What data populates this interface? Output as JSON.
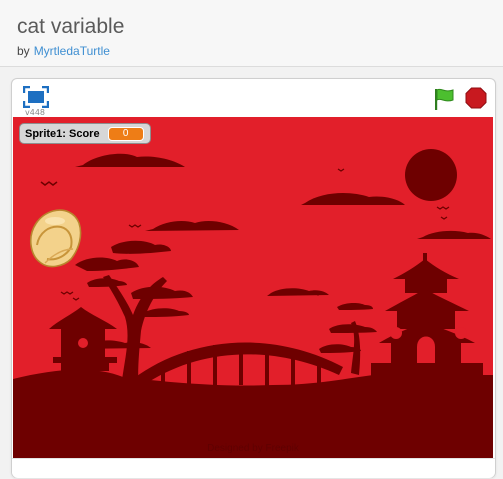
{
  "project": {
    "title": "cat variable",
    "by_label": "by",
    "author": "MyrtledaTurtle"
  },
  "player": {
    "version": "v448",
    "icons": {
      "fullscreen": "fullscreen-icon",
      "green_flag": "green-flag-icon",
      "stop": "stop-sign-icon"
    },
    "colors": {
      "stage_background": "#e21f2a",
      "silhouette": "#6e0000",
      "monitor_value": "#ee7d16",
      "flag": "#4cbf2f",
      "stop": "#c8191f"
    }
  },
  "stage": {
    "monitor": {
      "label": "Sprite1: Score",
      "value": "0"
    },
    "sprite": "fortune-cookie",
    "watermark": "Designed by Freepik"
  }
}
